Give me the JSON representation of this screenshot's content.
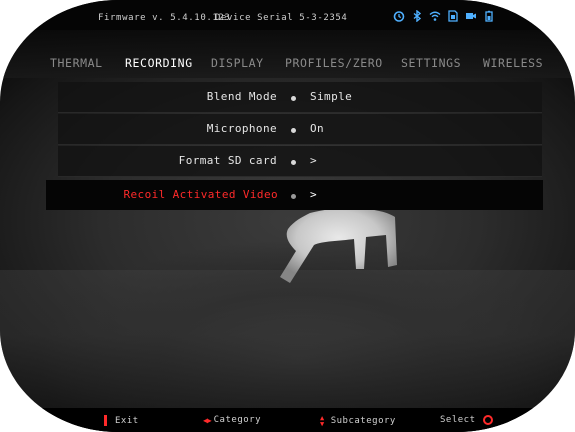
{
  "status_bar": {
    "firmware": "Firmware v. 5.4.10.123",
    "serial": "Device Serial 5-3-2354",
    "icons": [
      "timer-icon",
      "bluetooth-icon",
      "wifi-icon",
      "sd-card-icon",
      "video-record-icon",
      "battery-icon"
    ]
  },
  "tabs": [
    {
      "label": "THERMAL",
      "active": false
    },
    {
      "label": "RECORDING",
      "active": true
    },
    {
      "label": "DISPLAY",
      "active": false
    },
    {
      "label": "PROFILES/ZERO",
      "active": false
    },
    {
      "label": "SETTINGS",
      "active": false
    },
    {
      "label": "WIRELESS",
      "active": false
    }
  ],
  "menu": [
    {
      "label": "Blend Mode",
      "value": "Simple"
    },
    {
      "label": "Microphone",
      "value": "On"
    },
    {
      "label": "Format SD card",
      "value": ">"
    },
    {
      "label": "Recoil Activated Video",
      "value": ">",
      "selected": true
    }
  ],
  "hints": {
    "exit": "Exit",
    "category": "Category",
    "subcategory": "Subcategory",
    "select": "Select"
  },
  "colors": {
    "accent": "#ff2a2a",
    "active_tab": "#ffffff",
    "inactive_tab": "#8a8a8a"
  }
}
